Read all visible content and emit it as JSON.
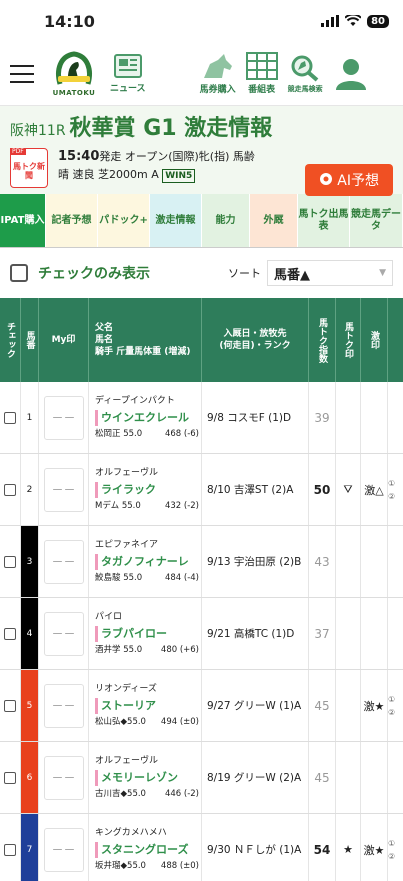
{
  "status": {
    "time": "14:10",
    "battery": "80"
  },
  "header": {
    "logo_text": "UMATOKU",
    "news_label": "ニュース",
    "ticket_label": "馬券購入",
    "card_label": "番組表",
    "search_label": "競走馬検索"
  },
  "race": {
    "venue": "阪神11R",
    "name": "秋華賞 G1 激走情報",
    "start_time": "15:40",
    "start_suffix": "発走 オープン(国際)牝(指) 馬齢",
    "conditions": "晴 速良 芝2000m A",
    "win5": "WIN5",
    "pdf_tag": "PDF",
    "pdf_text": "馬トク新聞",
    "ai_button": "AI予想"
  },
  "tabs": [
    {
      "label": "IPAT購入",
      "bg": "#1e9c4a",
      "fg": "#ffffff"
    },
    {
      "label": "記者予想",
      "bg": "#fdf7df",
      "fg": "#2f7d3a"
    },
    {
      "label": "パドック+",
      "bg": "#fdf7df",
      "fg": "#2f7d3a"
    },
    {
      "label": "激走情報",
      "bg": "#d8f1f3",
      "fg": "#2f7d3a"
    },
    {
      "label": "能力",
      "bg": "#e2f2e1",
      "fg": "#2f7d3a"
    },
    {
      "label": "外厩",
      "bg": "#fde5d4",
      "fg": "#2f7d3a"
    },
    {
      "label": "馬トク出馬表",
      "bg": "#e2f2e1",
      "fg": "#2f7d3a"
    },
    {
      "label": "競走馬データ",
      "bg": "#e2f2e1",
      "fg": "#2f7d3a"
    }
  ],
  "filter": {
    "label": "チェックのみ表示",
    "sort_label": "ソート",
    "sort_value": "馬番▲"
  },
  "columns": {
    "check": "チェック",
    "num": "馬番",
    "my": "My印",
    "horse": "父名\n馬名\n騎手 斤量馬体重 (増減)",
    "race": "入厩日・放牧先\n(何走目)・ランク",
    "index": "馬トク指数",
    "mark": "馬トク印",
    "geki": "激印"
  },
  "rows": [
    {
      "num": "1",
      "frame_color": "#ffffff",
      "num_color": "#222222",
      "my": "－－",
      "sire": "ディープインパクト",
      "horse": "ウインエクレール",
      "jockey": "松岡正 55.0",
      "weight": "468 (-6)",
      "race_info": "9/8 コスモF (1)D",
      "index": "39",
      "index_bold": false,
      "mark": "",
      "geki": "",
      "more": ""
    },
    {
      "num": "2",
      "frame_color": "#ffffff",
      "num_color": "#222222",
      "my": "－－",
      "sire": "オルフェーヴル",
      "horse": "ライラック",
      "jockey": "Mデム 55.0",
      "weight": "432 (-2)",
      "race_info": "8/10 吉澤ST (2)A",
      "index": "50",
      "index_bold": true,
      "mark": "⛛",
      "geki": "激△",
      "more": "① ②"
    },
    {
      "num": "3",
      "frame_color": "#000000",
      "num_color": "#ffffff",
      "my": "－－",
      "sire": "エピファネイア",
      "horse": "タガノフィナーレ",
      "jockey": "鮫島駿 55.0",
      "weight": "484 (-4)",
      "race_info": "9/13 宇治田原 (2)B",
      "index": "43",
      "index_bold": false,
      "mark": "",
      "geki": "",
      "more": ""
    },
    {
      "num": "4",
      "frame_color": "#000000",
      "num_color": "#ffffff",
      "my": "－－",
      "sire": "パイロ",
      "horse": "ラブパイロー",
      "jockey": "酒井学 55.0",
      "weight": "480 (+6)",
      "race_info": "9/21 高橋TC (1)D",
      "index": "37",
      "index_bold": false,
      "mark": "",
      "geki": "",
      "more": ""
    },
    {
      "num": "5",
      "frame_color": "#e8401c",
      "num_color": "#ffffff",
      "my": "－－",
      "sire": "リオンディーズ",
      "horse": "ストーリア",
      "jockey": "松山弘◆55.0",
      "weight": "494 (±0)",
      "race_info": "9/27 グリーW (1)A",
      "index": "45",
      "index_bold": false,
      "mark": "",
      "geki": "激★",
      "more": "① ②"
    },
    {
      "num": "6",
      "frame_color": "#e8401c",
      "num_color": "#ffffff",
      "my": "－－",
      "sire": "オルフェーヴル",
      "horse": "メモリーレゾン",
      "jockey": "古川吉◆55.0",
      "weight": "446 (-2)",
      "race_info": "8/19 グリーW (2)A",
      "index": "45",
      "index_bold": false,
      "mark": "",
      "geki": "",
      "more": ""
    },
    {
      "num": "7",
      "frame_color": "#1f3f99",
      "num_color": "#ffffff",
      "my": "－－",
      "sire": "キングカメハメハ",
      "horse": "スタニングローズ",
      "jockey": "坂井瑠◆55.0",
      "weight": "488 (±0)",
      "race_info": "9/30 ＮＦしが (1)A",
      "index": "54",
      "index_bold": true,
      "mark": "★",
      "geki": "激★",
      "more": "① ②"
    }
  ]
}
